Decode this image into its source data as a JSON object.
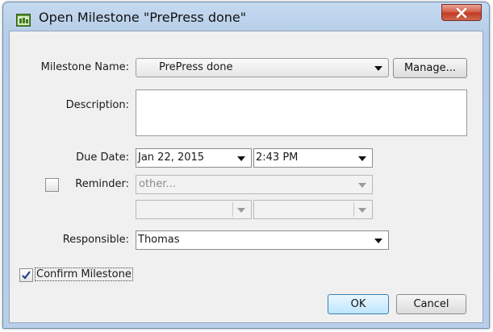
{
  "window": {
    "title": "Open Milestone \"PrePress done\"",
    "close_label": "X"
  },
  "form": {
    "milestone_name_label": "Milestone Name:",
    "milestone_name_value": "PrePress done",
    "manage_label": "Manage...",
    "description_label": "Description:",
    "description_value": "",
    "due_date_label": "Due Date:",
    "due_date_value": "Jan 22, 2015",
    "due_time_value": "2:43 PM",
    "reminder_label": "Reminder:",
    "reminder_checked": false,
    "reminder_value": "other...",
    "reminder_sub1_value": "",
    "reminder_sub2_value": "",
    "responsible_label": "Responsible:",
    "responsible_value": "Thomas",
    "confirm_label": "Confirm Milestone",
    "confirm_checked": true
  },
  "buttons": {
    "ok_label": "OK",
    "cancel_label": "Cancel"
  },
  "colors": {
    "titlebar": "#b9cfe9",
    "close_button": "#c9452c",
    "dialog_background": "#f0f0f0",
    "default_button": "#bee6fd"
  }
}
